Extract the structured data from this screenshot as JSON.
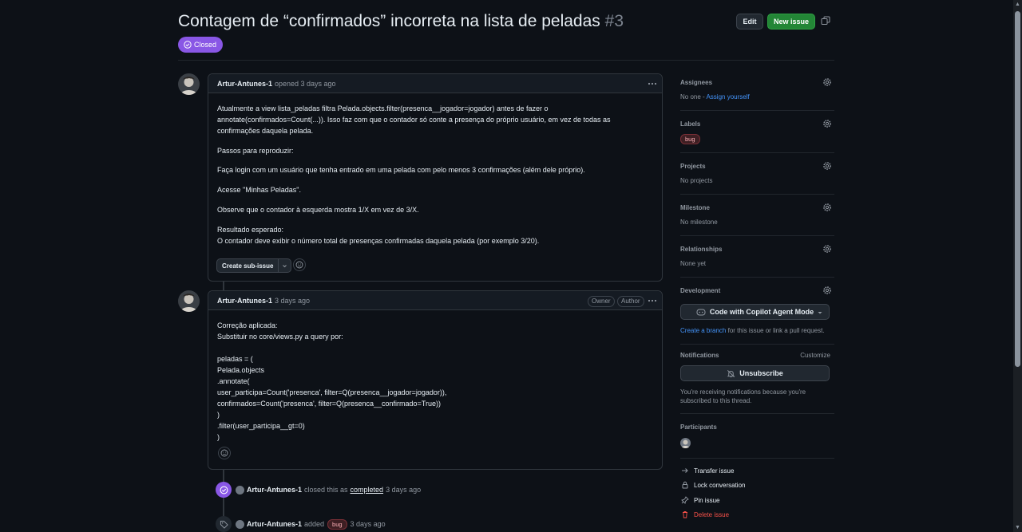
{
  "issue": {
    "title": "Contagem de “confirmados” incorreta na lista de peladas",
    "number": "#3",
    "state": "Closed"
  },
  "header": {
    "edit_label": "Edit",
    "new_issue_label": "New issue"
  },
  "first_comment": {
    "author": "Artur-Antunes-1",
    "meta": "opened 3 days ago",
    "body": [
      "Atualmente a view lista_peladas filtra Pelada.objects.filter(presenca__jogador=jogador) antes de fazer o annotate(confirmados=Count(...)). Isso faz com que o contador só conte a presença do próprio usuário, em vez de todas as confirmações daquela pelada.",
      "Passos para reproduzir:",
      "Faça login com um usuário que tenha entrado em uma pelada com pelo menos 3 confirmações (além dele próprio).",
      "Acesse \"Minhas Peladas\".",
      "Observe que o contador à esquerda mostra 1/X em vez de 3/X.",
      "Resultado esperado:",
      "O contador deve exibir o número total de presenças confirmadas daquela pelada (por exemplo 3/20)."
    ],
    "create_subissue_label": "Create sub-issue"
  },
  "second_comment": {
    "author": "Artur-Antunes-1",
    "meta": "3 days ago",
    "owner_tag": "Owner",
    "author_tag": "Author",
    "body": [
      "Correção aplicada:",
      "Substituir no core/views.py a query por:",
      "",
      "peladas = (",
      "Pelada.objects",
      ".annotate(",
      "user_participa=Count('presenca', filter=Q(presenca__jogador=jogador)),",
      "confirmados=Count('presenca', filter=Q(presenca__confirmado=True))",
      ")",
      ".filter(user_participa__gt=0)",
      ")"
    ]
  },
  "events": {
    "closed": {
      "author": "Artur-Antunes-1",
      "text_before": "closed this as",
      "link": "completed",
      "time": "3 days ago"
    },
    "labeled": {
      "author": "Artur-Antunes-1",
      "text_before": "added",
      "label": "bug",
      "time": "3 days ago"
    }
  },
  "sidebar": {
    "assignees": {
      "heading": "Assignees",
      "value": "No one - ",
      "link": "Assign yourself"
    },
    "labels": {
      "heading": "Labels",
      "label": "bug"
    },
    "projects": {
      "heading": "Projects",
      "value": "No projects"
    },
    "milestone": {
      "heading": "Milestone",
      "value": "No milestone"
    },
    "relationships": {
      "heading": "Relationships",
      "value": "None yet"
    },
    "development": {
      "heading": "Development",
      "copilot_button": "Code with Copilot Agent Mode",
      "link": "Create a branch",
      "text_after": " for this issue or link a pull request."
    },
    "notifications": {
      "heading": "Notifications",
      "customize": "Customize",
      "button": "Unsubscribe",
      "note": "You're receiving notifications because you're subscribed to this thread."
    },
    "participants": {
      "heading": "Participants"
    },
    "actions": {
      "transfer": "Transfer issue",
      "lock": "Lock conversation",
      "pin": "Pin issue",
      "delete": "Delete issue"
    }
  },
  "colors": {
    "background": "#0d1117",
    "closed_badge": "#8957e5",
    "new_issue_button": "#238636",
    "link": "#4493f8",
    "danger": "#f85149"
  }
}
